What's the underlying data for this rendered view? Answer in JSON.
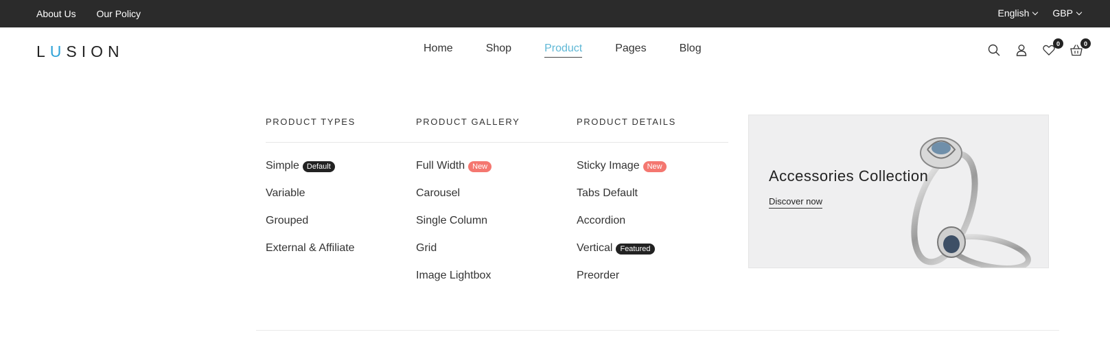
{
  "topbar": {
    "links": [
      "About Us",
      "Our Policy"
    ],
    "language": "English",
    "currency": "GBP"
  },
  "header": {
    "logo_prefix": "L",
    "logo_accent": "U",
    "logo_suffix": "SION",
    "nav": [
      "Home",
      "Shop",
      "Product",
      "Pages",
      "Blog"
    ],
    "active_nav": "Product",
    "wishlist_count": "0",
    "cart_count": "0"
  },
  "mega_menu": {
    "columns": [
      {
        "title": "PRODUCT TYPES",
        "items": [
          {
            "label": "Simple",
            "tag": "Default"
          },
          {
            "label": "Variable"
          },
          {
            "label": "Grouped"
          },
          {
            "label": "External & Affiliate"
          }
        ]
      },
      {
        "title": "PRODUCT GALLERY",
        "items": [
          {
            "label": "Full Width",
            "tag": "New"
          },
          {
            "label": "Carousel"
          },
          {
            "label": "Single Column"
          },
          {
            "label": "Grid"
          },
          {
            "label": "Image Lightbox"
          }
        ]
      },
      {
        "title": "PRODUCT DETAILS",
        "items": [
          {
            "label": "Sticky Image",
            "tag": "New"
          },
          {
            "label": "Tabs Default"
          },
          {
            "label": "Accordion"
          },
          {
            "label": "Vertical",
            "tag": "Featured"
          },
          {
            "label": "Preorder"
          }
        ]
      }
    ],
    "banner": {
      "title": "Accessories Collection",
      "link": "Discover now"
    }
  },
  "colors": {
    "accent": "#5fb8d6",
    "topbar_bg": "#2b2b2b",
    "tag_new": "#f47770",
    "tag_dark": "#222222"
  }
}
